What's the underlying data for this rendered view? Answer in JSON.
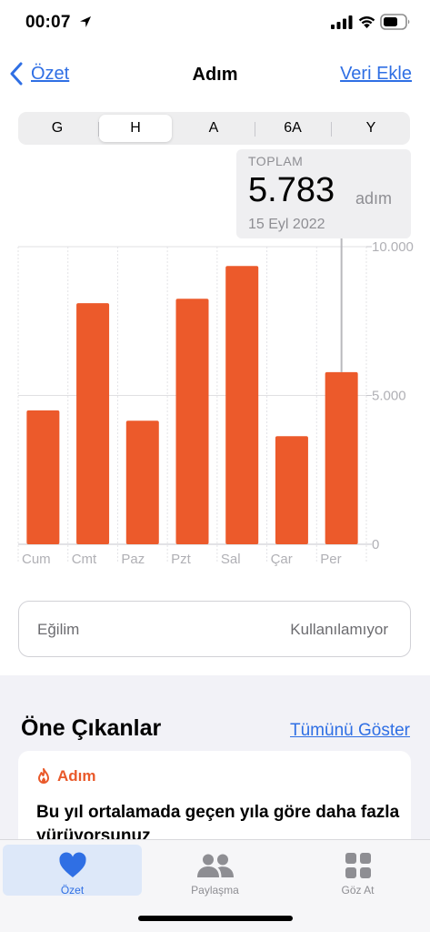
{
  "status": {
    "time": "00:07"
  },
  "nav": {
    "back_label": "Özet",
    "title": "Adım",
    "action_label": "Veri Ekle"
  },
  "segments": [
    {
      "label": "G",
      "active": false
    },
    {
      "label": "H",
      "active": true
    },
    {
      "label": "A",
      "active": false
    },
    {
      "label": "6A",
      "active": false
    },
    {
      "label": "Y",
      "active": false
    }
  ],
  "tooltip": {
    "label": "TOPLAM",
    "value": "5.783",
    "unit": "adım",
    "date": "15 Eyl 2022"
  },
  "chart_data": {
    "type": "bar",
    "categories": [
      "Cum",
      "Cmt",
      "Paz",
      "Pzt",
      "Sal",
      "Çar",
      "Per"
    ],
    "values": [
      4500,
      8100,
      4150,
      8250,
      9350,
      3630,
      5783
    ],
    "y_ticks": [
      "10.000",
      "5.000",
      "0"
    ],
    "ylim": [
      0,
      10000
    ],
    "bar_color": "#ec5a2b",
    "selected_index": 6
  },
  "trend": {
    "label": "Eğilim",
    "value": "Kullanılamıyor"
  },
  "highlights": {
    "title": "Öne Çıkanlar",
    "link_label": "Tümünü Göster",
    "card": {
      "category": "Adım",
      "text": "Bu yıl ortalamada geçen yıla göre daha fazla yürüyorsunuz"
    }
  },
  "tabbar": {
    "items": [
      {
        "label": "Özet",
        "icon": "heart-icon",
        "active": true
      },
      {
        "label": "Paylaşma",
        "icon": "people-icon",
        "active": false
      },
      {
        "label": "Göz At",
        "icon": "grid-icon",
        "active": false
      }
    ]
  },
  "colors": {
    "accent": "#2f6fe4",
    "bar": "#ec5a2b",
    "highlight": "#e9592a"
  }
}
